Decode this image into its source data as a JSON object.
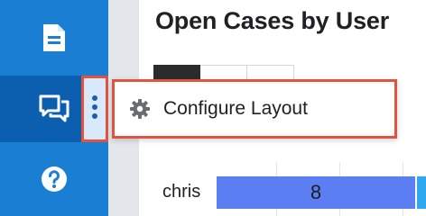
{
  "sidebar": {
    "items": [
      {
        "icon": "document-icon"
      },
      {
        "icon": "chat-bubbles-icon"
      },
      {
        "icon": "help-icon"
      }
    ],
    "more_button_icon": "vertical-ellipsis-icon"
  },
  "dashlet": {
    "title": "Open Cases by User",
    "tabs": [
      {
        "active": true
      },
      {
        "active": false
      },
      {
        "active": false
      }
    ],
    "rows": [
      {
        "label": "chris",
        "value": "8"
      }
    ]
  },
  "menu": {
    "items": [
      {
        "icon": "gear-icon",
        "label": "Configure Layout"
      }
    ]
  },
  "colors": {
    "sidebar": "#1a7ed3",
    "sidebar_active": "#0b5fae",
    "highlight": "#e0533f",
    "bar": "#5b7ff2"
  }
}
